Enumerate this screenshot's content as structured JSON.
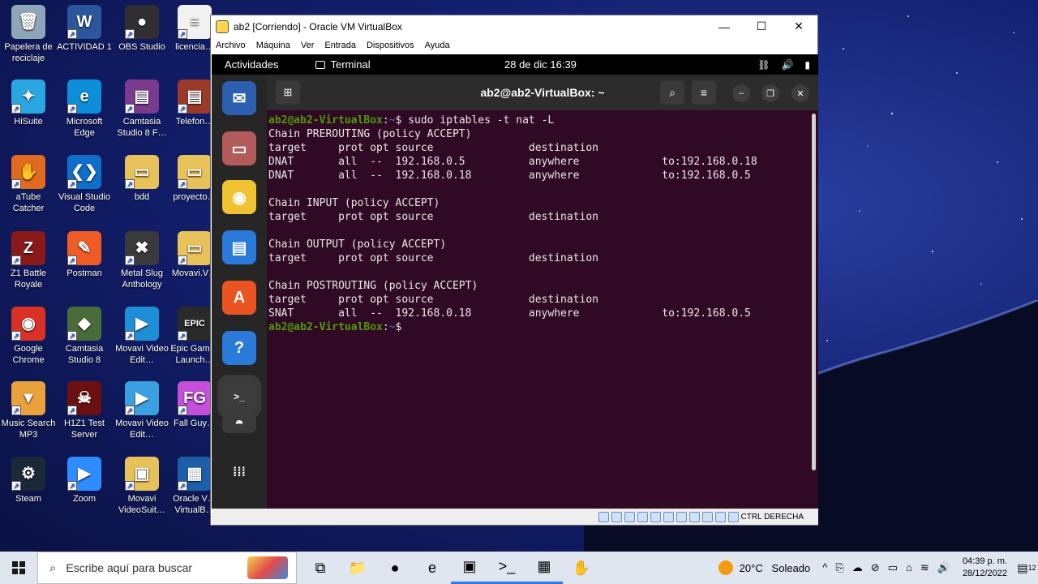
{
  "desktop": {
    "icons": [
      {
        "label": "Papelera de reciclaje",
        "color": "#8fa5b8",
        "glyph": "🗑"
      },
      {
        "label": "ACTIVIDAD 1",
        "color": "#2b579a",
        "glyph": "W"
      },
      {
        "label": "OBS Studio",
        "color": "#302e31",
        "glyph": "●"
      },
      {
        "label": "licencia…",
        "color": "#f2f2f2",
        "glyph": "≡"
      },
      {
        "label": "HiSuite",
        "color": "#2aa6e3",
        "glyph": "✦"
      },
      {
        "label": "Microsoft Edge",
        "color": "#0c8ed8",
        "glyph": "e"
      },
      {
        "label": "Camtasia Studio 8 F…",
        "color": "#7a3b8f",
        "glyph": "▤"
      },
      {
        "label": "Telefon…",
        "color": "#9b3a2a",
        "glyph": "▤"
      },
      {
        "label": "aTube Catcher",
        "color": "#e06b1f",
        "glyph": "✋"
      },
      {
        "label": "Visual Studio Code",
        "color": "#0e6ec9",
        "glyph": "❮❯"
      },
      {
        "label": "bdd",
        "color": "#e7c15a",
        "glyph": "▭"
      },
      {
        "label": "proyecto…",
        "color": "#e7c15a",
        "glyph": "▭"
      },
      {
        "label": "Z1 Battle Royale",
        "color": "#8a1a1a",
        "glyph": "Z"
      },
      {
        "label": "Postman",
        "color": "#ef5b25",
        "glyph": "✎"
      },
      {
        "label": "Metal Slug Anthology",
        "color": "#3a3a3a",
        "glyph": "✖"
      },
      {
        "label": "Movavi.V…",
        "color": "#e7c15a",
        "glyph": "▭"
      },
      {
        "label": "Google Chrome",
        "color": "#d93025",
        "glyph": "◉"
      },
      {
        "label": "Camtasia Studio 8",
        "color": "#4a6b3a",
        "glyph": "◆"
      },
      {
        "label": "Movavi Video Edit…",
        "color": "#1e8fd6",
        "glyph": "▶"
      },
      {
        "label": "Epic Gam… Launch…",
        "color": "#2a2a2a",
        "glyph": "EPIC"
      },
      {
        "label": "Music Search MP3",
        "color": "#e9a13b",
        "glyph": "▼"
      },
      {
        "label": "H1Z1 Test Server",
        "color": "#6b1010",
        "glyph": "☠"
      },
      {
        "label": "Movavi Video Edit…",
        "color": "#3aa0e0",
        "glyph": "▶"
      },
      {
        "label": "Fall Guy…",
        "color": "#c44fd8",
        "glyph": "FG"
      },
      {
        "label": "Steam",
        "color": "#1b2838",
        "glyph": "⚙"
      },
      {
        "label": "Zoom",
        "color": "#2d8cff",
        "glyph": "▶"
      },
      {
        "label": "Movavi VideoSuit…",
        "color": "#e7c15a",
        "glyph": "▣"
      },
      {
        "label": "Oracle V… VirtualB…",
        "color": "#1c5fa8",
        "glyph": "▦"
      }
    ]
  },
  "vbox": {
    "title": "ab2 [Corriendo] - Oracle VM VirtualBox",
    "controls": {
      "minimize": "—",
      "maximize": "☐",
      "close": "✕"
    },
    "menu": [
      "Archivo",
      "Máquina",
      "Ver",
      "Entrada",
      "Dispositivos",
      "Ayuda"
    ],
    "status_host_key": "CTRL DERECHA"
  },
  "guest": {
    "topbar": {
      "activities": "Actividades",
      "app": "Terminal",
      "datetime": "28 de dic  16:39",
      "tray": [
        "⛓",
        "🔊",
        "▮"
      ]
    },
    "dock": [
      {
        "name": "thunderbird",
        "color": "#2d5fb0",
        "glyph": "✉"
      },
      {
        "name": "files",
        "color": "#b35a5a",
        "glyph": "▭"
      },
      {
        "name": "rhythmbox",
        "color": "#f1c232",
        "glyph": "◉"
      },
      {
        "name": "writer",
        "color": "#2a7ad9",
        "glyph": "▤"
      },
      {
        "name": "software",
        "color": "#e95420",
        "glyph": "A"
      },
      {
        "name": "help",
        "color": "#2a7ad9",
        "glyph": "?"
      },
      {
        "name": "terminal",
        "color": "#3c3c3c",
        "glyph": ">_"
      },
      {
        "name": "optical-drive",
        "color": "#3a3a3a",
        "glyph": "◓"
      },
      {
        "name": "show-apps",
        "color": "#262626",
        "glyph": "⁞⁞⁞"
      }
    ],
    "terminal": {
      "title": "ab2@ab2-VirtualBox: ~",
      "prompt_user": "ab2@ab2-VirtualBox",
      "prompt_path": "~",
      "command": "sudo iptables -t nat -L",
      "output": [
        "Chain PREROUTING (policy ACCEPT)",
        "target     prot opt source               destination",
        "DNAT       all  --  192.168.0.5          anywhere             to:192.168.0.18",
        "DNAT       all  --  192.168.0.18         anywhere             to:192.168.0.5",
        "",
        "Chain INPUT (policy ACCEPT)",
        "target     prot opt source               destination",
        "",
        "Chain OUTPUT (policy ACCEPT)",
        "target     prot opt source               destination",
        "",
        "Chain POSTROUTING (policy ACCEPT)",
        "target     prot opt source               destination",
        "SNAT       all  --  192.168.0.18         anywhere             to:192.168.0.5"
      ]
    }
  },
  "taskbar": {
    "search_placeholder": "Escribe aquí para buscar",
    "pinned": [
      {
        "name": "task-view",
        "glyph": "⧉"
      },
      {
        "name": "file-explorer",
        "glyph": "📁"
      },
      {
        "name": "obs",
        "glyph": "●"
      },
      {
        "name": "edge",
        "glyph": "e"
      },
      {
        "name": "app-active",
        "glyph": "▣"
      },
      {
        "name": "terminal",
        "glyph": ">_"
      },
      {
        "name": "virtualbox",
        "glyph": "▦"
      },
      {
        "name": "atube",
        "glyph": "✋"
      }
    ],
    "weather": {
      "temp": "20°C",
      "desc": "Soleado"
    },
    "tray_icons": [
      "^",
      "⎘",
      "☁",
      "⊘",
      "▭",
      "⌂",
      "≋",
      "🔊"
    ],
    "time": "04:39 p. m.",
    "date": "28/12/2022",
    "notif_count": "12"
  }
}
